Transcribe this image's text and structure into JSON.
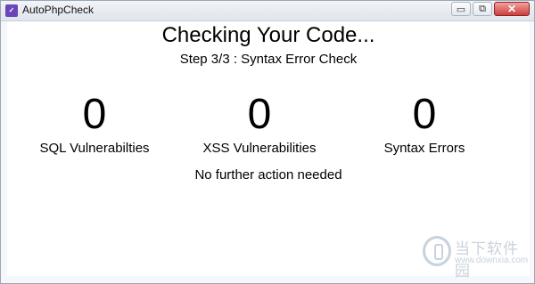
{
  "window": {
    "title": "AutoPhpCheck",
    "controls": {
      "minimize": "▭",
      "restore": "⧉",
      "close": "✕"
    }
  },
  "main": {
    "heading": "Checking Your Code...",
    "step": "Step 3/3 : Syntax Error Check",
    "stats": [
      {
        "value": "0",
        "label": "SQL Vulnerabilties"
      },
      {
        "value": "0",
        "label": "XSS Vulnerabilities"
      },
      {
        "value": "0",
        "label": "Syntax Errors"
      }
    ],
    "status": "No further action needed"
  },
  "watermark": {
    "text": "当下软件园",
    "url": "www.downxia.com"
  }
}
